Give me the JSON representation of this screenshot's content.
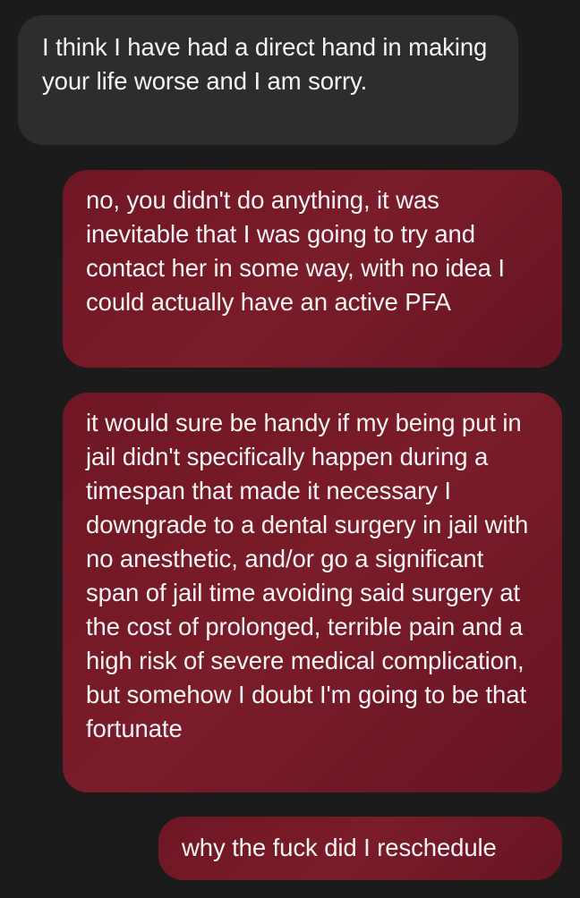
{
  "conversation": {
    "messages": [
      {
        "direction": "incoming",
        "text": "I think I have had a direct hand in making your life worse and I am sorry."
      },
      {
        "direction": "outgoing",
        "text": "no, you didn't do anything, it was inevitable that I was going to try and contact her in some way, with no idea I could actually have an active PFA"
      },
      {
        "direction": "outgoing",
        "text": "it would sure be handy if my being put in jail didn't specifically happen during a timespan that made it necessary I downgrade to a dental surgery in jail with no anesthetic, and/or go a significant span of jail time avoiding said surgery at the cost of prolonged, terrible pain and a high risk of severe medical complication, but somehow I doubt I'm going to be that fortunate"
      },
      {
        "direction": "outgoing",
        "text": "why the fuck did I reschedule"
      }
    ]
  },
  "colors": {
    "background": "#1b1b1b",
    "incoming_bubble": "#2f2c2c",
    "outgoing_bubble": "#701624",
    "text": "#f3f3f3"
  }
}
